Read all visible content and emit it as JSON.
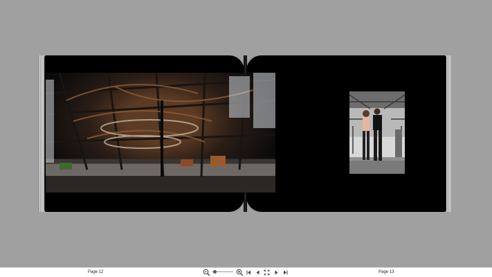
{
  "toolbar": {
    "left_page_label": "Page 12",
    "right_page_label": "Page 13",
    "zoom_level": 0.05,
    "buttons": {
      "zoom_out": "zoom-out-icon",
      "zoom_in": "zoom-in-icon",
      "first_page": "first-page-icon",
      "previous_page": "previous-page-icon",
      "spread_view": "two-page-spread-icon",
      "next_page": "next-page-icon",
      "last_page": "last-page-icon"
    }
  },
  "colors": {
    "viewer_background": "#a0a0a0",
    "page": "#000000",
    "toolbar": "#ffffff"
  }
}
